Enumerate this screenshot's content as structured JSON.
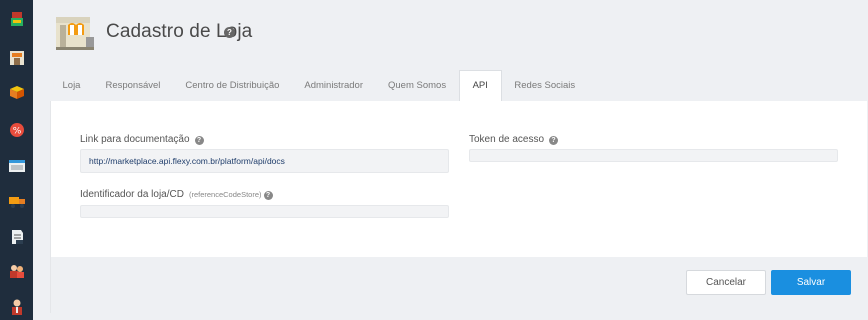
{
  "header": {
    "title": "Cadastro de Loja",
    "help_glyph": "?"
  },
  "sidebar": {
    "items": [
      {
        "icon": "cube-stack-icon"
      },
      {
        "icon": "store-icon"
      },
      {
        "icon": "box-icon"
      },
      {
        "icon": "discount-icon"
      },
      {
        "icon": "window-icon"
      },
      {
        "icon": "truck-icon"
      },
      {
        "icon": "document-icon"
      },
      {
        "icon": "users-icon"
      },
      {
        "icon": "user-icon"
      }
    ]
  },
  "tabs": [
    {
      "label": "Loja",
      "active": false
    },
    {
      "label": "Responsável",
      "active": false
    },
    {
      "label": "Centro de Distribuição",
      "active": false
    },
    {
      "label": "Administrador",
      "active": false
    },
    {
      "label": "Quem Somos",
      "active": false
    },
    {
      "label": "API",
      "active": true
    },
    {
      "label": "Redes Sociais",
      "active": false
    }
  ],
  "form": {
    "doc_link": {
      "label": "Link para documentação",
      "value": "http://marketplace.api.flexy.com.br/platform/api/docs"
    },
    "token": {
      "label": "Token de acesso",
      "value": ""
    },
    "store_id": {
      "label": "Identificador da loja/CD",
      "sublabel": "(referenceCodeStore)",
      "value": ""
    }
  },
  "buttons": {
    "cancel": "Cancelar",
    "save": "Salvar"
  },
  "colors": {
    "sidebar": "#1f2d3d",
    "primary": "#1a8fe0",
    "link_text": "#1f3d6b"
  }
}
